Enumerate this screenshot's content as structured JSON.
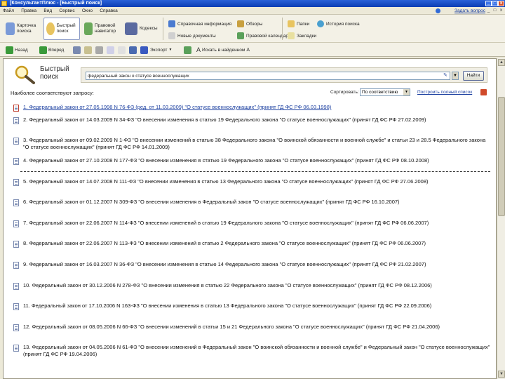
{
  "window": {
    "title": "[КонсультантПлюс - [Быстрый поиск]",
    "buttons": [
      "_",
      "□",
      "x"
    ]
  },
  "menu": {
    "items": [
      "Файл",
      "Правка",
      "Вид",
      "Сервис",
      "Окно",
      "Справка"
    ],
    "support_link": "Задать вопрос",
    "window_controls": [
      "_",
      "□",
      "x"
    ]
  },
  "toolbar": {
    "card_search": "Карточка поиска",
    "quick_search": "Быстрый поиск",
    "legal_navigator": "Правовой навигатор",
    "codes": "Кодексы",
    "reference_info": "Справочная информация",
    "reviews": "Обзоры",
    "new_documents": "Новые документы",
    "prices": "Правовой календарь",
    "folders": "Папки",
    "history": "История поиска",
    "bookmarks": "Закладки"
  },
  "toolbar2": {
    "back": "Назад",
    "forward": "Вперед",
    "export": "Экспорт",
    "find_in_list": "Искать в найденном"
  },
  "search": {
    "title": "Быстрый поиск",
    "query": "федеральный закон о статусе военнослужащих",
    "button": "Найти"
  },
  "results": {
    "header": "Наиболее соответствуют запросу:",
    "sort_label": "Сортировать:",
    "sort_value": "По соответствию",
    "build_full_list": "Построить полный список",
    "items": [
      "1. Федеральный закон от 27.05.1998 N 76-ФЗ (ред. от 11.03.2009) \"О статусе военнослужащих\" (принят ГД ФС РФ 06.03.1998)",
      "2. Федеральный закон от 14.03.2009 N 34-ФЗ \"О внесении изменения в статью 19 Федерального закона \"О статусе военнослужащих\" (принят ГД ФС РФ 27.02.2009)",
      "3. Федеральный закон от 09.02.2009 N 1-ФЗ \"О внесении изменений в статью 38 Федерального закона \"О воинской обязанности и военной службе\" и статьи 23 и 28.5 Федерального закона \"О статусе военнослужащих\" (принят ГД ФС РФ 14.01.2009)",
      "4. Федеральный закон от 27.10.2008 N 177-ФЗ \"О внесении изменения в статью 19 Федерального закона \"О статусе военнослужащих\" (принят ГД ФС РФ 08.10.2008)",
      "5. Федеральный закон от 14.07.2008 N 111-ФЗ \"О внесении изменения в статью 13 Федерального закона \"О статусе военнослужащих\" (принят ГД ФС РФ 27.06.2008)",
      "6. Федеральный закон от 01.12.2007 N 309-ФЗ \"О внесении изменения в Федеральный закон \"О статусе военнослужащих\" (принят ГД ФС РФ 16.10.2007)",
      "7. Федеральный закон от 22.06.2007 N 114-ФЗ \"О внесении изменений в статью 19 Федерального закона \"О статусе военнослужащих\" (принят ГД ФС РФ 06.06.2007)",
      "8. Федеральный закон от 22.06.2007 N 113-ФЗ \"О внесении изменений в статью 2 Федерального закона \"О статусе военнослужащих\" (принят ГД ФС РФ 06.06.2007)",
      "9. Федеральный закон от 16.03.2007 N 36-ФЗ \"О внесении изменения в статью 14 Федерального закона \"О статусе военнослужащих\" (принят ГД ФС РФ 21.02.2007)",
      "10. Федеральный закон от 30.12.2006 N 278-ФЗ \"О внесении изменения в статью 22 Федерального закона \"О статусе военнослужащих\" (принят ГД ФС РФ 08.12.2006)",
      "11. Федеральный закон от 17.10.2006 N 163-ФЗ \"О внесении изменения в статью 13 Федерального закона \"О статусе военнослужащих\" (принят ГД ФС РФ 22.09.2006)",
      "12. Федеральный закон от 08.05.2006 N 66-ФЗ \"О внесении изменений в статьи 15 и 21 Федерального закона \"О статусе военнослужащих\" (принят ГД ФС РФ 21.04.2006)",
      "13. Федеральный закон от 04.05.2006 N 61-ФЗ \"О внесении изменений в Федеральный закон \"О воинской обязанности и военной службе\" и Федеральный закон \"О статусе военнослужащих\" (принят ГД ФС РФ 19.04.2006)"
    ]
  },
  "colors": {
    "link": "#1b3fa0",
    "title_bar": "#0a3cb4"
  }
}
